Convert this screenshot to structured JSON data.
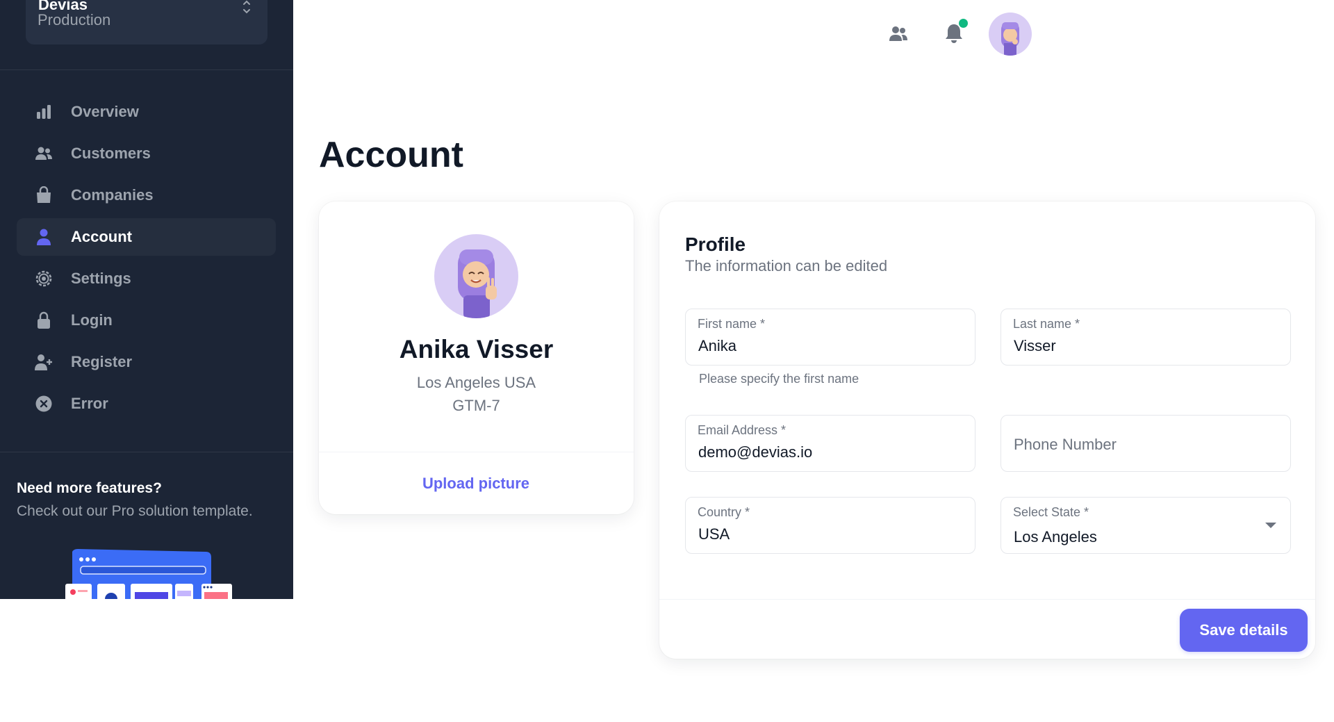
{
  "workspace": {
    "name": "Devias",
    "environment": "Production"
  },
  "nav": {
    "items": [
      {
        "label": "Overview",
        "icon": "chart-bar-icon",
        "active": false
      },
      {
        "label": "Customers",
        "icon": "users-icon",
        "active": false
      },
      {
        "label": "Companies",
        "icon": "shopping-bag-icon",
        "active": false
      },
      {
        "label": "Account",
        "icon": "user-icon",
        "active": true
      },
      {
        "label": "Settings",
        "icon": "cog-icon",
        "active": false
      },
      {
        "label": "Login",
        "icon": "lock-icon",
        "active": false
      },
      {
        "label": "Register",
        "icon": "user-plus-icon",
        "active": false
      },
      {
        "label": "Error",
        "icon": "x-circle-icon",
        "active": false
      }
    ]
  },
  "promo": {
    "title": "Need more features?",
    "text": "Check out our Pro solution template."
  },
  "topbar": {
    "icons": [
      "contacts-icon",
      "bell-icon",
      "user-avatar"
    ],
    "notification_dot_color": "#10b981"
  },
  "page": {
    "title": "Account"
  },
  "profile_card": {
    "name": "Anika Visser",
    "city": "Los Angeles USA",
    "timezone": "GTM-7",
    "upload_label": "Upload picture"
  },
  "form": {
    "title": "Profile",
    "subtitle": "The information can be edited",
    "first_name": {
      "label": "First name *",
      "value": "Anika",
      "helper": "Please specify the first name"
    },
    "last_name": {
      "label": "Last name *",
      "value": "Visser"
    },
    "email": {
      "label": "Email Address *",
      "value": "demo@devias.io"
    },
    "phone": {
      "placeholder": "Phone Number"
    },
    "country": {
      "label": "Country *",
      "value": "USA"
    },
    "state": {
      "label": "Select State *",
      "value": "Los Angeles"
    },
    "save_label": "Save details"
  },
  "colors": {
    "sidebar_bg": "#1c2536",
    "accent": "#6366f1",
    "text_primary": "#111927",
    "text_secondary": "#6c737f",
    "success": "#10b981"
  }
}
